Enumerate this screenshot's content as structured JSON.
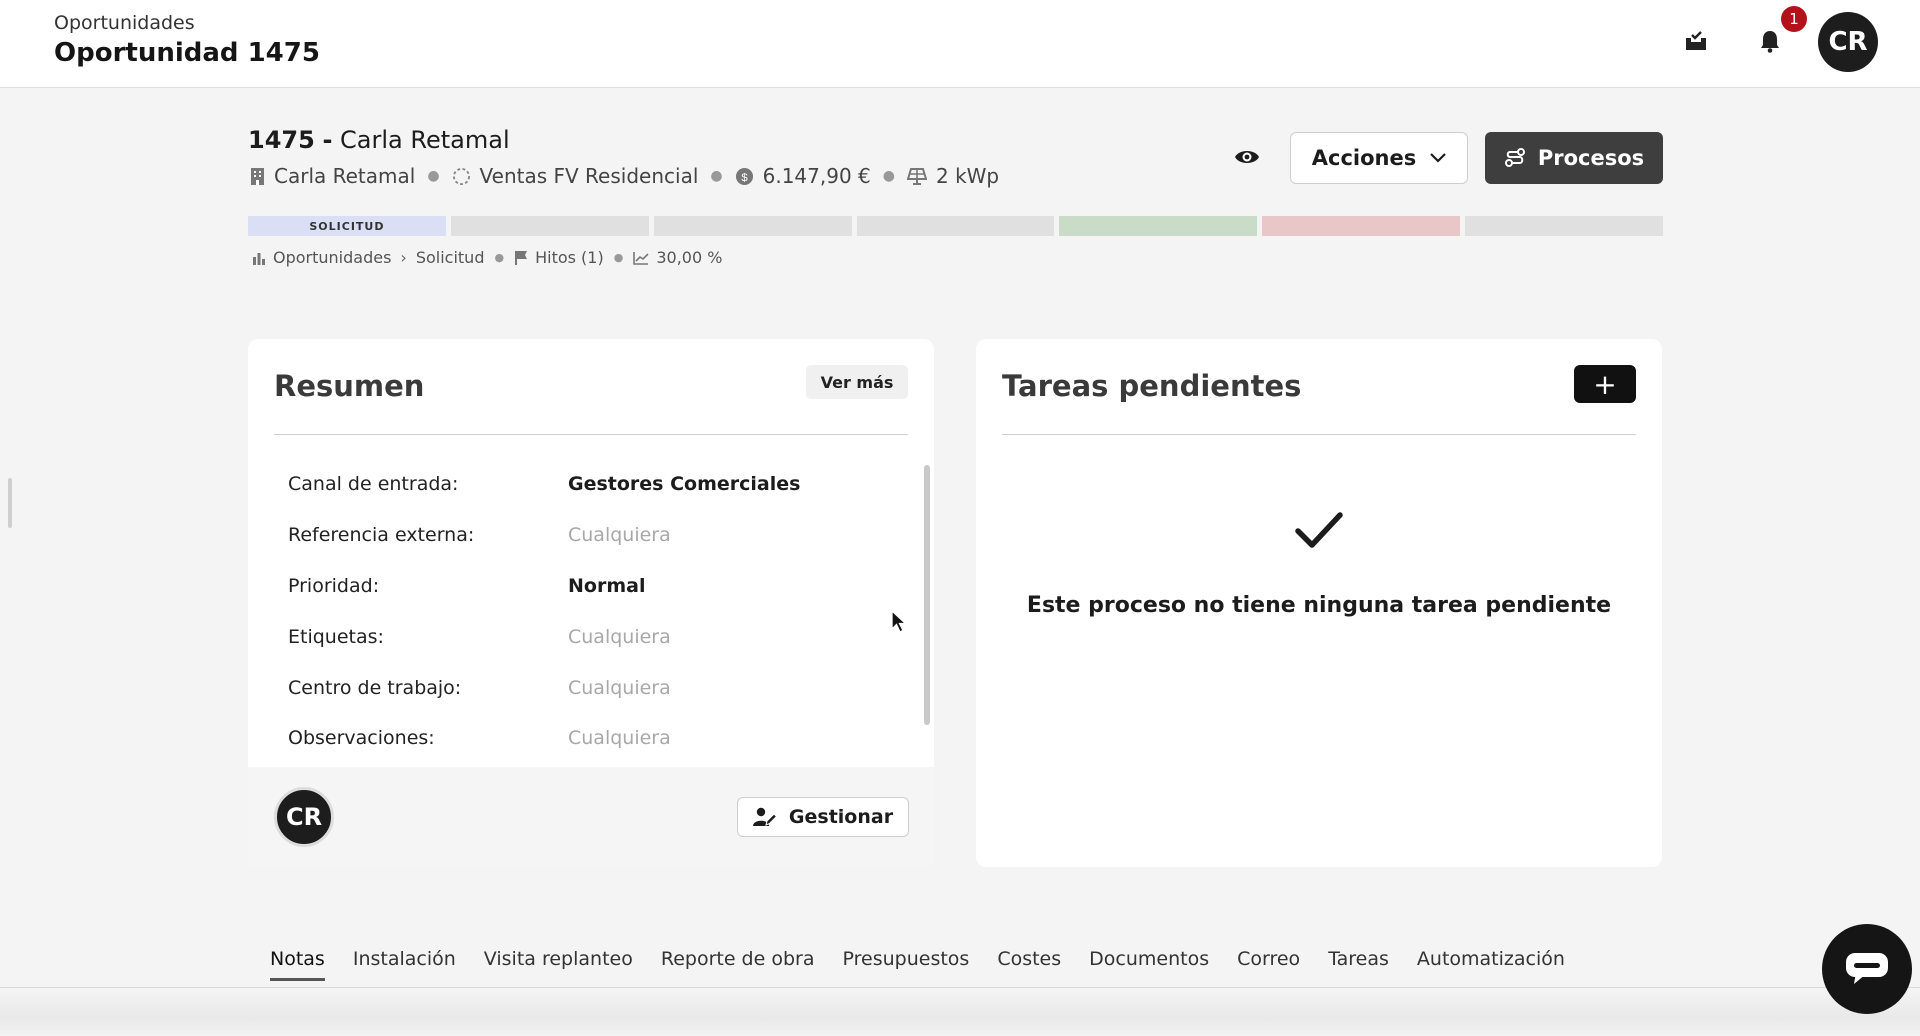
{
  "header": {
    "breadcrumb": "Oportunidades",
    "title": "Oportunidad 1475",
    "notification_count": "1",
    "user_initials": "CR"
  },
  "record": {
    "number": "1475",
    "separator": "-",
    "name": "Carla Retamal",
    "client": "Carla Retamal",
    "pipeline": "Ventas FV Residencial",
    "amount": "6.147,90 €",
    "power": "2 kWp",
    "actions_label": "Acciones",
    "processes_label": "Procesos"
  },
  "stages": {
    "items": [
      {
        "label": "SOLICITUD",
        "state": "active"
      },
      {
        "label": "",
        "state": "pending"
      },
      {
        "label": "",
        "state": "pending"
      },
      {
        "label": "",
        "state": "pending"
      },
      {
        "label": "",
        "state": "won"
      },
      {
        "label": "",
        "state": "lost"
      },
      {
        "label": "",
        "state": "pending"
      }
    ],
    "colors": {
      "active": "#dadff5",
      "pending": "#e0e0e0",
      "won": "#c8dcc8",
      "lost": "#e9c7c9"
    }
  },
  "sub_meta": {
    "section": "Oportunidades",
    "stage": "Solicitud",
    "milestones": "Hitos (1)",
    "probability": "30,00 %"
  },
  "summary": {
    "title": "Resumen",
    "more_label": "Ver más",
    "rows": [
      {
        "label": "Canal de entrada:",
        "value": "Gestores Comerciales",
        "placeholder": false
      },
      {
        "label": "Referencia externa:",
        "value": "Cualquiera",
        "placeholder": true
      },
      {
        "label": "Prioridad:",
        "value": "Normal",
        "placeholder": false
      },
      {
        "label": "Etiquetas:",
        "value": "Cualquiera",
        "placeholder": true
      },
      {
        "label": "Centro de trabajo:",
        "value": "Cualquiera",
        "placeholder": true
      },
      {
        "label": "Observaciones:",
        "value": "Cualquiera",
        "placeholder": true
      }
    ],
    "owner_initials": "CR",
    "manage_label": "Gestionar"
  },
  "tasks": {
    "title": "Tareas pendientes",
    "add_label": "+",
    "empty_message": "Este proceso no tiene ninguna tarea pendiente"
  },
  "tabs": {
    "items": [
      "Notas",
      "Instalación",
      "Visita replanteo",
      "Reporte de obra",
      "Presupuestos",
      "Costes",
      "Documentos",
      "Correo",
      "Tareas",
      "Automatización"
    ],
    "active_index": 0
  }
}
